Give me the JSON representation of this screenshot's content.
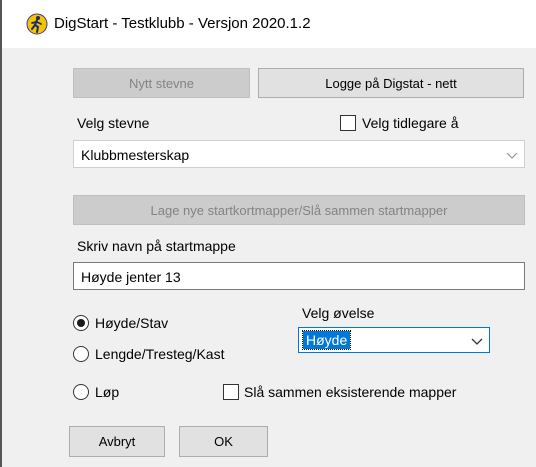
{
  "window": {
    "title": "DigStart - Testklubb - Versjon 2020.1.2",
    "icon": "runner-icon"
  },
  "buttons": {
    "new_event": "Nytt stevne",
    "login": "Logge på Digstat - nett",
    "make_folders": "Lage nye startkortmapper/Slå sammen startmapper",
    "cancel": "Avbryt",
    "ok": "OK"
  },
  "event_select": {
    "label": "Velg stevne",
    "value": "Klubbmesterskap",
    "earlier_checkbox_label": "Velg tidlegare å",
    "earlier_checked": false
  },
  "folder_name": {
    "label": "Skriv navn på startmappe",
    "value": "Høyde jenter 13"
  },
  "radio_options": [
    {
      "label": "Høyde/Stav",
      "selected": true
    },
    {
      "label": "Lengde/Tresteg/Kast",
      "selected": false
    },
    {
      "label": "Løp",
      "selected": false
    }
  ],
  "exercise_select": {
    "label": "Velg øvelse",
    "value": "Høyde"
  },
  "merge_checkbox": {
    "label": "Slå sammen eksisterende mapper",
    "checked": false
  },
  "colors": {
    "accent": "#0078d7",
    "dialog_bg": "#f0f0f0",
    "disabled_text": "#838383"
  }
}
